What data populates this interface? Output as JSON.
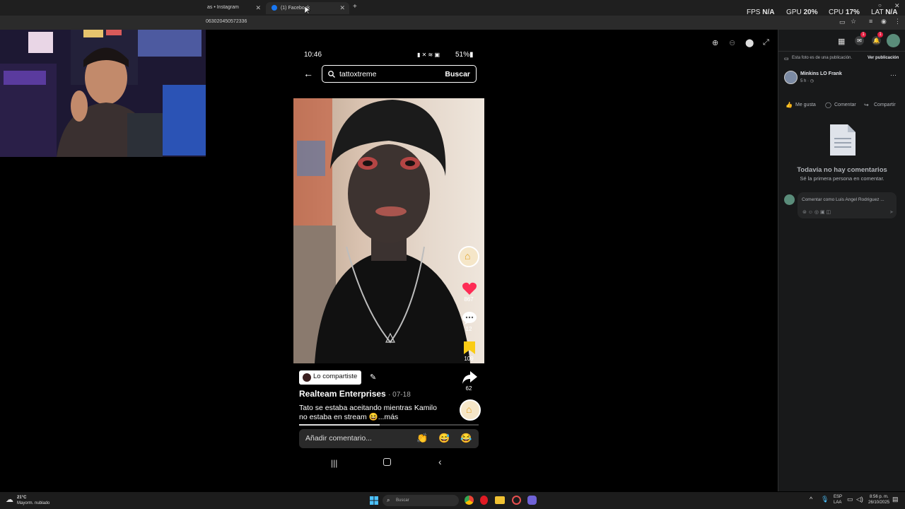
{
  "browser": {
    "tabs": [
      {
        "label": "as • Instagram"
      },
      {
        "label": "(1) Facebook"
      }
    ],
    "url": "063020450572336"
  },
  "overlay_stats": {
    "fps_label": "FPS",
    "fps_value": "N/A",
    "gpu_label": "GPU",
    "gpu_value": "20%",
    "cpu_label": "CPU",
    "cpu_value": "17%",
    "lat_label": "LAT",
    "lat_value": "N/A"
  },
  "phone": {
    "time": "10:46",
    "battery": "51%",
    "search_query": "tattoxtreme",
    "search_button": "Buscar",
    "likes": "867",
    "comments": "12",
    "saves": "109",
    "shares": "62",
    "shared_chip": "Lo compartiste",
    "author": "Realteam Enterprises",
    "date": "· 07-18",
    "caption_line1": "Tato se estaba aceitando mientras Kamilo",
    "caption_line2": "no estaba en stream 😆...más",
    "comment_placeholder": "Añadir comentario...",
    "emoji_reactions": [
      "👏",
      "😅",
      "😂"
    ],
    "progress": 0.45
  },
  "facebook": {
    "notice": "Esta foto es de una publicación.",
    "view_post": "Ver publicación",
    "poster_name": "Minkins LO Frank",
    "poster_time": "5 h · ",
    "like": "Me gusta",
    "comment": "Comentar",
    "share": "Compartir",
    "no_comments_title": "Todavía no hay comentarios",
    "no_comments_sub": "Sé la primera persona en comentar.",
    "comment_as": "Comentar como Luis Angel Rodriguez ...",
    "messenger_badge": "1",
    "notif_badge": "1"
  },
  "taskbar": {
    "weather_temp": "21°C",
    "weather_desc": "Mayorm. nublado",
    "search": "Buscar",
    "lang1": "ESP",
    "lang2": "LAA",
    "time": "8:56 p. m.",
    "date": "26/10/2025"
  },
  "colors": {
    "fb_bg": "#18191a",
    "like_heart": "#fe2c55",
    "bookmark": "#facc15"
  }
}
